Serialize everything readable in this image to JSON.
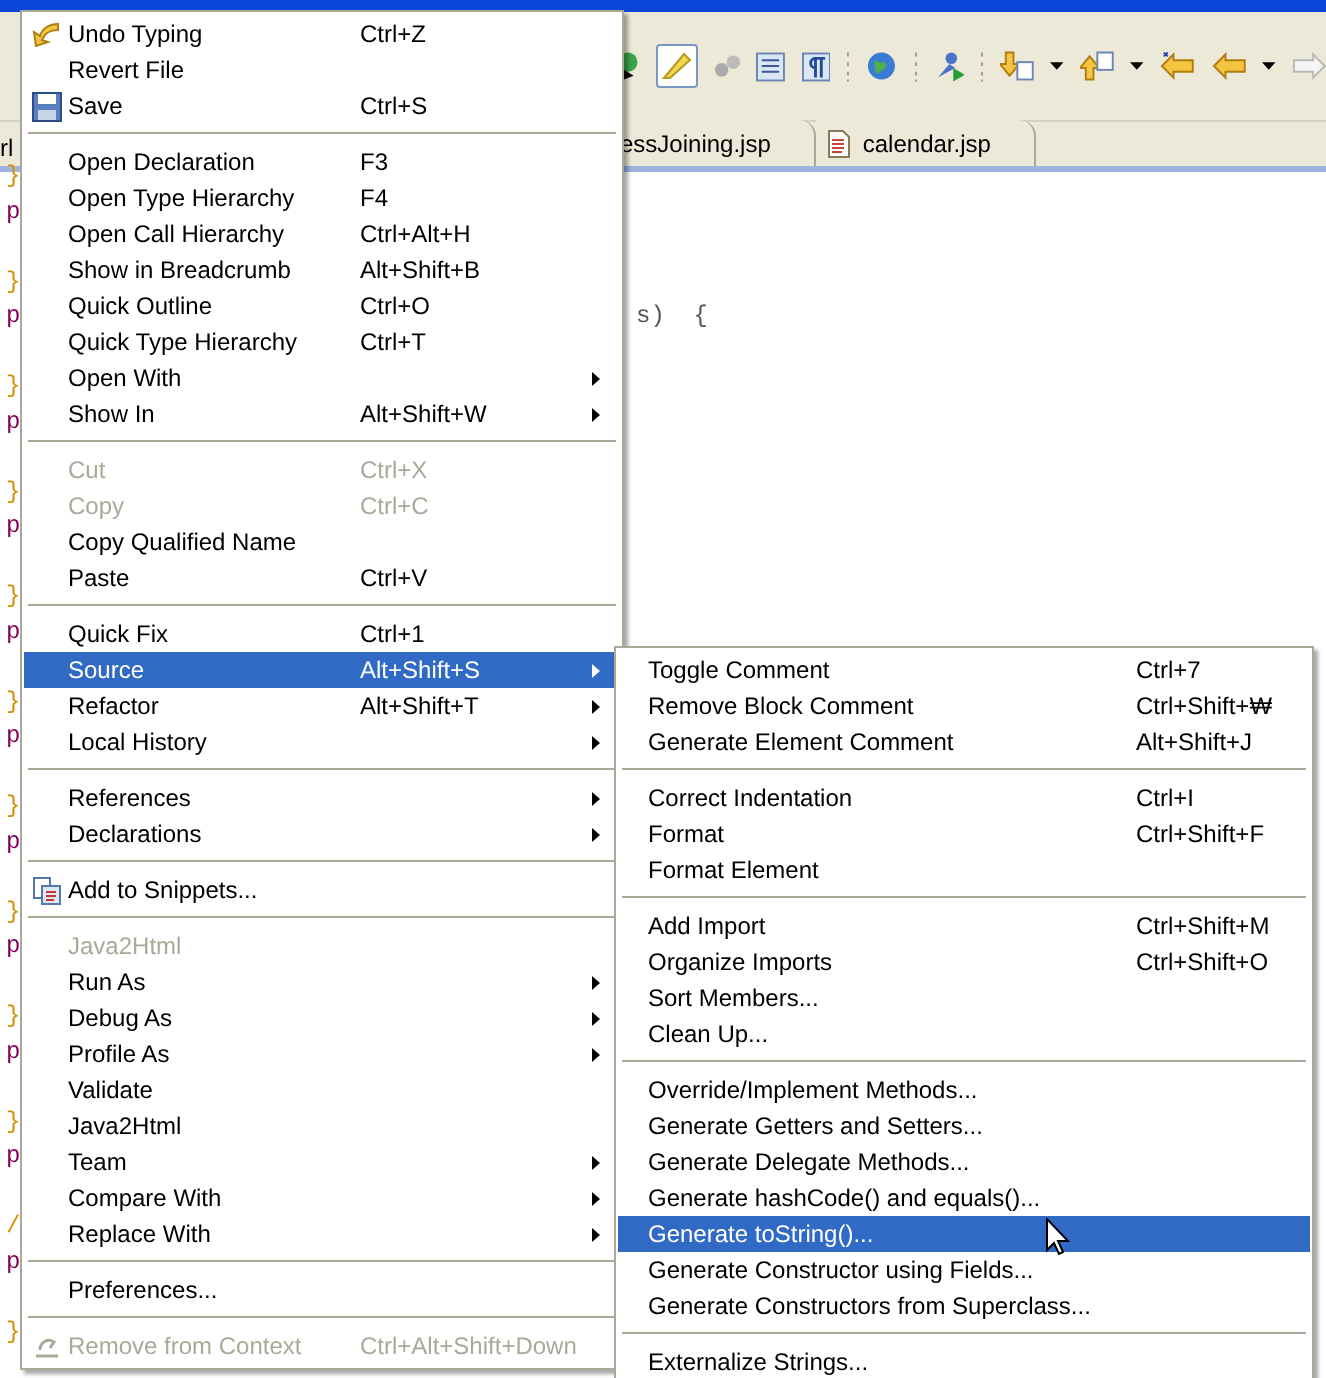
{
  "editor_tabs": [
    {
      "label": "essJoining.jsp",
      "selected": false,
      "kind": "plain"
    },
    {
      "label": "calendar.jsp",
      "selected": false,
      "kind": "file"
    }
  ],
  "left_tab_fragment": "rl",
  "left_code_fragments": [
    [
      "}",
      "p"
    ],
    [
      "}",
      "p"
    ],
    [
      "}",
      "p"
    ],
    [
      "}",
      "p"
    ],
    [
      "}",
      "p"
    ],
    [
      "}",
      "p"
    ],
    [
      "}",
      "p"
    ],
    [
      "}",
      "p"
    ],
    [
      "}",
      "p"
    ],
    [
      "}",
      "p"
    ],
    [
      "/",
      "p"
    ],
    [
      "}"
    ]
  ],
  "code_fragment": "s)  {",
  "context_menu": {
    "sections": [
      [
        {
          "label": "Undo Typing",
          "shortcut": "Ctrl+Z",
          "kind": "undo",
          "submenu": false,
          "disabled": false,
          "selected": false
        },
        {
          "label": "Revert File",
          "kind": "plain",
          "submenu": false,
          "disabled": false,
          "selected": false
        },
        {
          "label": "Save",
          "shortcut": "Ctrl+S",
          "kind": "save",
          "submenu": false,
          "disabled": false,
          "selected": false
        }
      ],
      [
        {
          "label": "Open Declaration",
          "shortcut": "F3",
          "kind": "plain",
          "submenu": false,
          "disabled": false,
          "selected": false
        },
        {
          "label": "Open Type Hierarchy",
          "shortcut": "F4",
          "kind": "plain",
          "submenu": false,
          "disabled": false,
          "selected": false
        },
        {
          "label": "Open Call Hierarchy",
          "shortcut": "Ctrl+Alt+H",
          "kind": "plain",
          "submenu": false,
          "disabled": false,
          "selected": false
        },
        {
          "label": "Show in Breadcrumb",
          "shortcut": "Alt+Shift+B",
          "kind": "plain",
          "submenu": false,
          "disabled": false,
          "selected": false
        },
        {
          "label": "Quick Outline",
          "shortcut": "Ctrl+O",
          "kind": "plain",
          "submenu": false,
          "disabled": false,
          "selected": false
        },
        {
          "label": "Quick Type Hierarchy",
          "shortcut": "Ctrl+T",
          "kind": "plain",
          "submenu": false,
          "disabled": false,
          "selected": false
        },
        {
          "label": "Open With",
          "kind": "plain",
          "submenu": true,
          "disabled": false,
          "selected": false
        },
        {
          "label": "Show In",
          "shortcut": "Alt+Shift+W",
          "kind": "plain",
          "submenu": true,
          "disabled": false,
          "selected": false
        }
      ],
      [
        {
          "label": "Cut",
          "shortcut": "Ctrl+X",
          "kind": "plain",
          "submenu": false,
          "disabled": true,
          "selected": false
        },
        {
          "label": "Copy",
          "shortcut": "Ctrl+C",
          "kind": "plain",
          "submenu": false,
          "disabled": true,
          "selected": false
        },
        {
          "label": "Copy Qualified Name",
          "kind": "plain",
          "submenu": false,
          "disabled": false,
          "selected": false
        },
        {
          "label": "Paste",
          "shortcut": "Ctrl+V",
          "kind": "plain",
          "submenu": false,
          "disabled": false,
          "selected": false
        }
      ],
      [
        {
          "label": "Quick Fix",
          "shortcut": "Ctrl+1",
          "kind": "plain",
          "submenu": false,
          "disabled": false,
          "selected": false
        },
        {
          "label": "Source",
          "shortcut": "Alt+Shift+S",
          "kind": "plain",
          "submenu": true,
          "disabled": false,
          "selected": true
        },
        {
          "label": "Refactor",
          "shortcut": "Alt+Shift+T",
          "kind": "plain",
          "submenu": true,
          "disabled": false,
          "selected": false
        },
        {
          "label": "Local History",
          "kind": "plain",
          "submenu": true,
          "disabled": false,
          "selected": false
        }
      ],
      [
        {
          "label": "References",
          "kind": "plain",
          "submenu": true,
          "disabled": false,
          "selected": false
        },
        {
          "label": "Declarations",
          "kind": "plain",
          "submenu": true,
          "disabled": false,
          "selected": false
        }
      ],
      [
        {
          "label": "Add to Snippets...",
          "kind": "snippets",
          "submenu": false,
          "disabled": false,
          "selected": false
        }
      ],
      [
        {
          "label": "Java2Html",
          "kind": "plain",
          "submenu": false,
          "disabled": true,
          "selected": false
        },
        {
          "label": "Run As",
          "kind": "plain",
          "submenu": true,
          "disabled": false,
          "selected": false
        },
        {
          "label": "Debug As",
          "kind": "plain",
          "submenu": true,
          "disabled": false,
          "selected": false
        },
        {
          "label": "Profile As",
          "kind": "plain",
          "submenu": true,
          "disabled": false,
          "selected": false
        },
        {
          "label": "Validate",
          "kind": "plain",
          "submenu": false,
          "disabled": false,
          "selected": false
        },
        {
          "label": "Java2Html",
          "kind": "plain",
          "submenu": false,
          "disabled": false,
          "selected": false
        },
        {
          "label": "Team",
          "kind": "plain",
          "submenu": true,
          "disabled": false,
          "selected": false
        },
        {
          "label": "Compare With",
          "kind": "plain",
          "submenu": true,
          "disabled": false,
          "selected": false
        },
        {
          "label": "Replace With",
          "kind": "plain",
          "submenu": true,
          "disabled": false,
          "selected": false
        }
      ],
      [
        {
          "label": "Preferences...",
          "kind": "plain",
          "submenu": false,
          "disabled": false,
          "selected": false
        }
      ],
      [
        {
          "label": "Remove from Context",
          "shortcut": "Ctrl+Alt+Shift+Down",
          "kind": "context",
          "submenu": false,
          "disabled": true,
          "selected": false
        }
      ]
    ]
  },
  "source_submenu": {
    "sections": [
      [
        {
          "label": "Toggle Comment",
          "shortcut": "Ctrl+7",
          "selected": false
        },
        {
          "label": "Remove Block Comment",
          "shortcut": "Ctrl+Shift+₩",
          "selected": false
        },
        {
          "label": "Generate Element Comment",
          "shortcut": "Alt+Shift+J",
          "selected": false
        }
      ],
      [
        {
          "label": "Correct Indentation",
          "shortcut": "Ctrl+I",
          "selected": false
        },
        {
          "label": "Format",
          "shortcut": "Ctrl+Shift+F",
          "selected": false
        },
        {
          "label": "Format Element",
          "selected": false
        }
      ],
      [
        {
          "label": "Add Import",
          "shortcut": "Ctrl+Shift+M",
          "selected": false
        },
        {
          "label": "Organize Imports",
          "shortcut": "Ctrl+Shift+O",
          "selected": false
        },
        {
          "label": "Sort Members...",
          "selected": false
        },
        {
          "label": "Clean Up...",
          "selected": false
        }
      ],
      [
        {
          "label": "Override/Implement Methods...",
          "selected": false
        },
        {
          "label": "Generate Getters and Setters...",
          "selected": false
        },
        {
          "label": "Generate Delegate Methods...",
          "selected": false
        },
        {
          "label": "Generate hashCode() and equals()...",
          "selected": false
        },
        {
          "label": "Generate toString()...",
          "selected": true
        },
        {
          "label": "Generate Constructor using Fields...",
          "selected": false
        },
        {
          "label": "Generate Constructors from Superclass...",
          "selected": false
        }
      ],
      [
        {
          "label": "Externalize Strings...",
          "selected": false
        }
      ]
    ]
  }
}
